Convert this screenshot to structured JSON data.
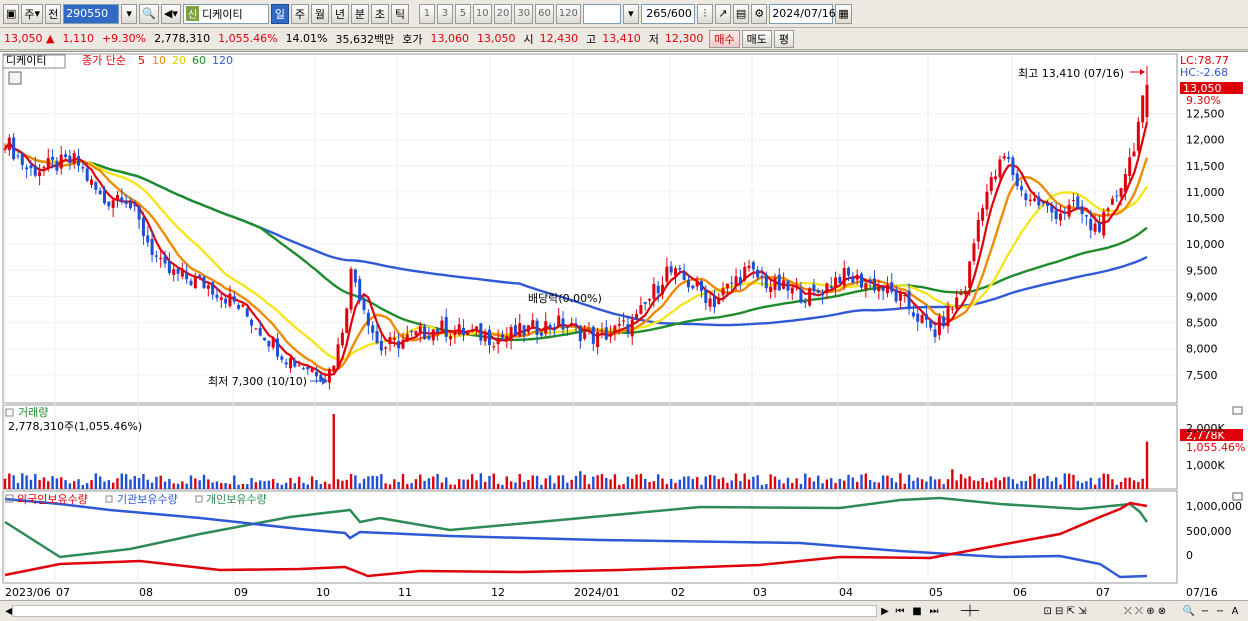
{
  "toolbar": {
    "market_label": "주",
    "prev_label": "전",
    "stock_code": "290550",
    "sin_badge": "신",
    "stock_name": "디케이티",
    "periods": [
      "일",
      "주",
      "월",
      "년",
      "분",
      "초",
      "틱"
    ],
    "active_period": "일",
    "intervals": [
      "1",
      "3",
      "5",
      "10",
      "20",
      "30",
      "60",
      "120"
    ],
    "count": "265",
    "count_total": "/600",
    "date": "2024/07/16"
  },
  "quote": {
    "price": "13,050",
    "change": "1,110",
    "change_pct": "+9.30%",
    "volume": "2,778,310",
    "volume_pct": "1,055.46%",
    "turnover": "14.01%",
    "amount": "35,632백만",
    "hoga_label": "호가",
    "hoga_ask": "13,060",
    "hoga_bid": "13,050",
    "open_label": "시",
    "open": "12,430",
    "high_label": "고",
    "high": "13,410",
    "low_label": "저",
    "low": "12,300",
    "buy_label": "매수",
    "sell_label": "매도",
    "eval_label": "평"
  },
  "price_panel": {
    "stock_name": "디케이티",
    "ma_label": "종가 단순",
    "ma_periods": [
      "5",
      "10",
      "20",
      "60",
      "120"
    ],
    "lc": "LC:78.77",
    "hc": "HC:-2.68",
    "high_note": "최고 13,410 (07/16)",
    "low_note": "최저 7,300 (10/10)",
    "dividend_note": "배당락(0.00%)",
    "current_tag": "13,050",
    "current_pct": "9.30%",
    "y_ticks": [
      "12,500",
      "12,000",
      "11,500",
      "11,000",
      "10,500",
      "10,000",
      "9,500",
      "9,000",
      "8,500",
      "8,000",
      "7,500"
    ]
  },
  "volume_panel": {
    "title": "거래량",
    "value": "2,778,310주(1,055.46%)",
    "tag": "2,778K",
    "tag_pct": "1,055.46%",
    "y_ticks": [
      "2,000K",
      "1,000K"
    ]
  },
  "holdings_panel": {
    "legend": [
      "외국인보유수량",
      "기관보유수량",
      "개인보유수량"
    ],
    "y_ticks": [
      "1,000,000",
      "500,000",
      "0"
    ]
  },
  "x_axis": {
    "labels": [
      "2023/06",
      "07",
      "08",
      "09",
      "10",
      "11",
      "12",
      "2024/01",
      "02",
      "03",
      "04",
      "05",
      "06",
      "07",
      "07/16"
    ]
  },
  "colors": {
    "up": "#e0000b",
    "down": "#1d4ed8",
    "ma5": "#e0000b",
    "ma10": "#f08a00",
    "ma20": "#f5e61c",
    "ma60": "#1e8c2a",
    "ma120": "#2f59d6",
    "foreign": "#e0000b",
    "institution": "#2f59d6",
    "individual": "#2e8b57"
  },
  "chart_data": {
    "type": "candlestick",
    "x": [
      "2023/06",
      "07",
      "08",
      "09",
      "10",
      "11",
      "12",
      "2024/01",
      "02",
      "03",
      "04",
      "05",
      "06",
      "07"
    ],
    "price_series": {
      "close": [
        11800,
        11400,
        10700,
        9300,
        9000,
        7600,
        8500,
        8400,
        8500,
        9200,
        9100,
        9300,
        8700,
        11300,
        11200,
        11000,
        13050
      ],
      "labels_anchor": [
        "2023/06",
        "2023/07",
        "2023/08",
        "2023/08b",
        "2023/09",
        "2023/10",
        "2023/11",
        "2023/12",
        "2024/01",
        "2024/02",
        "2024/03",
        "2024/04",
        "2024/04b",
        "2024/05",
        "2024/06",
        "2024/07",
        "2024/07/16"
      ]
    },
    "highlights": {
      "high": 13410,
      "low": 7300,
      "current": 13050
    },
    "ylim": [
      7000,
      13600
    ]
  }
}
